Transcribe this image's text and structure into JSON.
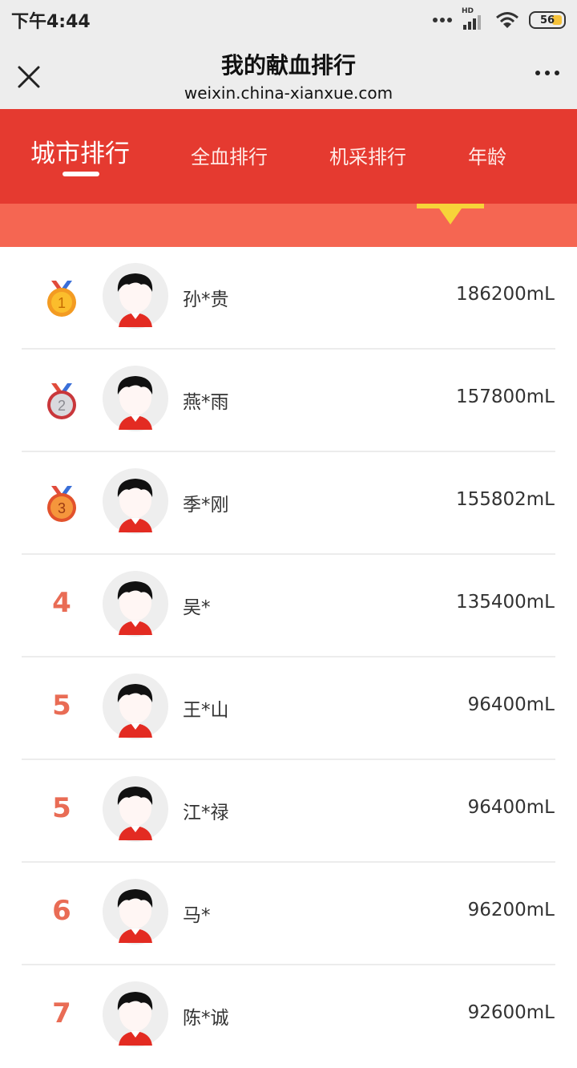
{
  "status_bar": {
    "time": "下午4:44",
    "hd": "HD",
    "battery": "56"
  },
  "title_bar": {
    "title": "我的献血排行",
    "url": "weixin.china-xianxue.com"
  },
  "tabs": [
    {
      "label": "城市排行",
      "active": true
    },
    {
      "label": "全血排行",
      "active": false
    },
    {
      "label": "机采排行",
      "active": false
    },
    {
      "label": "年龄",
      "active": false
    }
  ],
  "colors": {
    "primary_red": "#e53a30",
    "band": "#f56652",
    "rank_text": "#e96c55",
    "marker": "#f7d339"
  },
  "ranking": [
    {
      "rank": "1",
      "medal": "gold-medal-icon",
      "name": "孙*贵",
      "amount": "186200mL"
    },
    {
      "rank": "2",
      "medal": "silver-medal-icon",
      "name": "燕*雨",
      "amount": "157800mL"
    },
    {
      "rank": "3",
      "medal": "bronze-medal-icon",
      "name": "季*刚",
      "amount": "155802mL"
    },
    {
      "rank": "4",
      "name": "吴*",
      "amount": "135400mL"
    },
    {
      "rank": "5",
      "name": "王*山",
      "amount": "96400mL"
    },
    {
      "rank": "5",
      "name": "江*禄",
      "amount": "96400mL"
    },
    {
      "rank": "6",
      "name": "马*",
      "amount": "96200mL"
    },
    {
      "rank": "7",
      "name": "陈*诚",
      "amount": "92600mL"
    }
  ]
}
